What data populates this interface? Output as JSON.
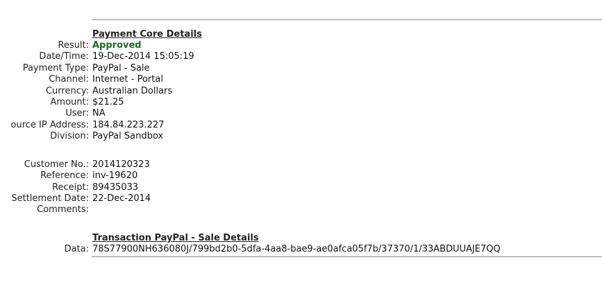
{
  "core": {
    "title": "Payment Core Details",
    "result_label": "Result:",
    "result_value": "Approved",
    "datetime_label": "Date/Time:",
    "datetime_value": "19-Dec-2014 15:05:19",
    "payment_type_label": "Payment Type:",
    "payment_type_value": "PayPal - Sale",
    "channel_label": "Channel:",
    "channel_value": "Internet - Portal",
    "currency_label": "Currency:",
    "currency_value": "Australian Dollars",
    "amount_label": "Amount:",
    "amount_value": "$21.25",
    "user_label": "User:",
    "user_value": "NA",
    "source_ip_label": "ource IP Address:",
    "source_ip_value": "184.84.223.227",
    "division_label": "Division:",
    "division_value": "PayPal Sandbox"
  },
  "customer": {
    "customer_no_label": "Customer No.:",
    "customer_no_value": "2014120323",
    "reference_label": "Reference:",
    "reference_value": "inv-19620",
    "receipt_label": "Receipt:",
    "receipt_value": "89435033",
    "settlement_label": "Settlement Date:",
    "settlement_value": "22-Dec-2014",
    "comments_label": "Comments:",
    "comments_value": ""
  },
  "transaction": {
    "title": "Transaction PayPal - Sale Details",
    "data_label": "Data:",
    "data_value": "78S77900NH636080J/799bd2b0-5dfa-4aa8-bae9-ae0afca05f7b/37370/1/33ABDUUAJE7QQ"
  },
  "colors": {
    "approved": "#1b6b1b",
    "rule": "#8a8a8a"
  }
}
